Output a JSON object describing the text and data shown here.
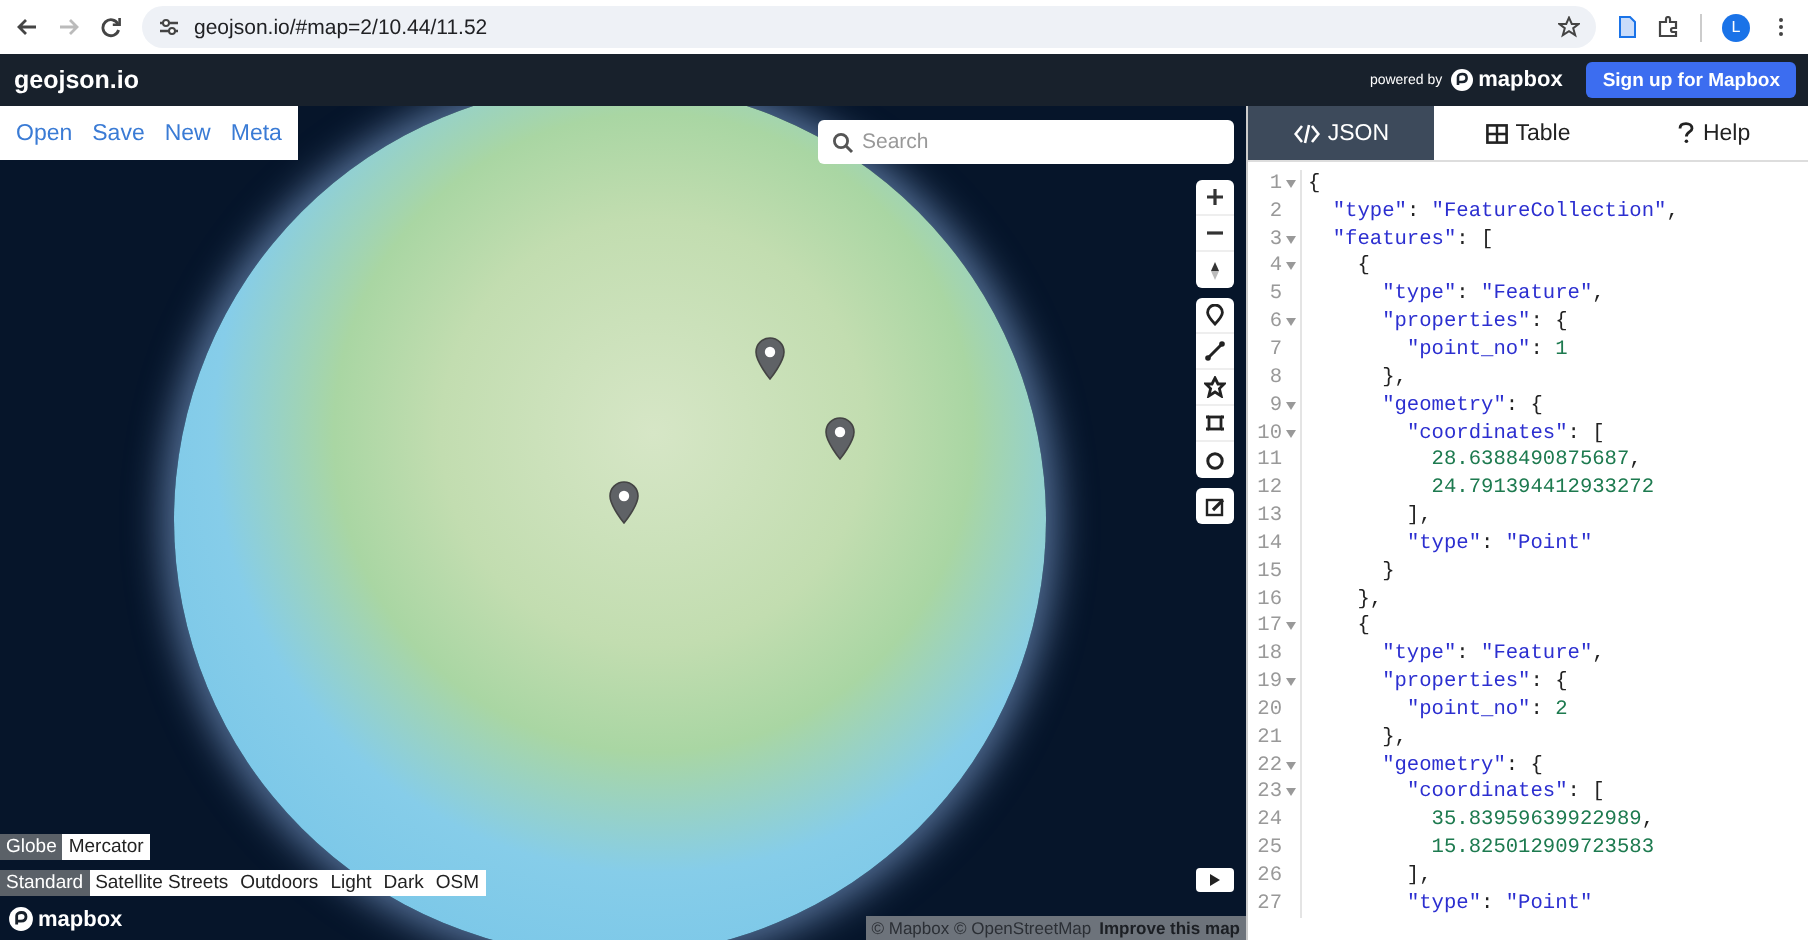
{
  "browser": {
    "url": "geojson.io/#map=2/10.44/11.52",
    "forward_disabled": true,
    "profile_initial": "L"
  },
  "header": {
    "title": "geojson.io",
    "powered_by": "powered by",
    "brand": "mapbox",
    "signup_button": "Sign up for Mapbox"
  },
  "map": {
    "menu": [
      "Open",
      "Save",
      "New",
      "Meta"
    ],
    "search": {
      "placeholder": "Search"
    },
    "projections": [
      {
        "label": "Globe",
        "selected": true
      },
      {
        "label": "Mercator",
        "selected": false
      }
    ],
    "styles": [
      {
        "label": "Standard",
        "selected": true
      },
      {
        "label": "Satellite Streets",
        "selected": false
      },
      {
        "label": "Outdoors",
        "selected": false
      },
      {
        "label": "Light",
        "selected": false
      },
      {
        "label": "Dark",
        "selected": false
      },
      {
        "label": "OSM",
        "selected": false
      }
    ],
    "logo": "mapbox",
    "attribution": "© Mapbox © OpenStreetMap",
    "improve_link": "Improve this map"
  },
  "panel": {
    "tabs": [
      {
        "label": "JSON",
        "kind": "code",
        "selected": true
      },
      {
        "label": "Table",
        "kind": "table",
        "selected": false
      },
      {
        "label": "Help",
        "kind": "help",
        "selected": false
      }
    ],
    "lines": [
      {
        "number": "1",
        "fold": true,
        "text": "{"
      },
      {
        "number": "2",
        "fold": false,
        "text": "  \"type\": \"FeatureCollection\","
      },
      {
        "number": "3",
        "fold": true,
        "text": "  \"features\": ["
      },
      {
        "number": "4",
        "fold": true,
        "text": "    {"
      },
      {
        "number": "5",
        "fold": false,
        "text": "      \"type\": \"Feature\","
      },
      {
        "number": "6",
        "fold": true,
        "text": "      \"properties\": {"
      },
      {
        "number": "7",
        "fold": false,
        "text": "        \"point_no\": 1"
      },
      {
        "number": "8",
        "fold": false,
        "text": "      },"
      },
      {
        "number": "9",
        "fold": true,
        "text": "      \"geometry\": {"
      },
      {
        "number": "10",
        "fold": true,
        "text": "        \"coordinates\": ["
      },
      {
        "number": "11",
        "fold": false,
        "text": "          28.6388490875687,"
      },
      {
        "number": "12",
        "fold": false,
        "text": "          24.791394412933272"
      },
      {
        "number": "13",
        "fold": false,
        "text": "        ],"
      },
      {
        "number": "14",
        "fold": false,
        "text": "        \"type\": \"Point\""
      },
      {
        "number": "15",
        "fold": false,
        "text": "      }"
      },
      {
        "number": "16",
        "fold": false,
        "text": "    },"
      },
      {
        "number": "17",
        "fold": true,
        "text": "    {"
      },
      {
        "number": "18",
        "fold": false,
        "text": "      \"type\": \"Feature\","
      },
      {
        "number": "19",
        "fold": true,
        "text": "      \"properties\": {"
      },
      {
        "number": "20",
        "fold": false,
        "text": "        \"point_no\": 2"
      },
      {
        "number": "21",
        "fold": false,
        "text": "      },"
      },
      {
        "number": "22",
        "fold": true,
        "text": "      \"geometry\": {"
      },
      {
        "number": "23",
        "fold": true,
        "text": "        \"coordinates\": ["
      },
      {
        "number": "24",
        "fold": false,
        "text": "          35.83959639922989,"
      },
      {
        "number": "25",
        "fold": false,
        "text": "          15.825012909723583"
      },
      {
        "number": "26",
        "fold": false,
        "text": "        ],"
      },
      {
        "number": "27",
        "fold": false,
        "text": "        \"type\": \"Point\""
      }
    ]
  }
}
